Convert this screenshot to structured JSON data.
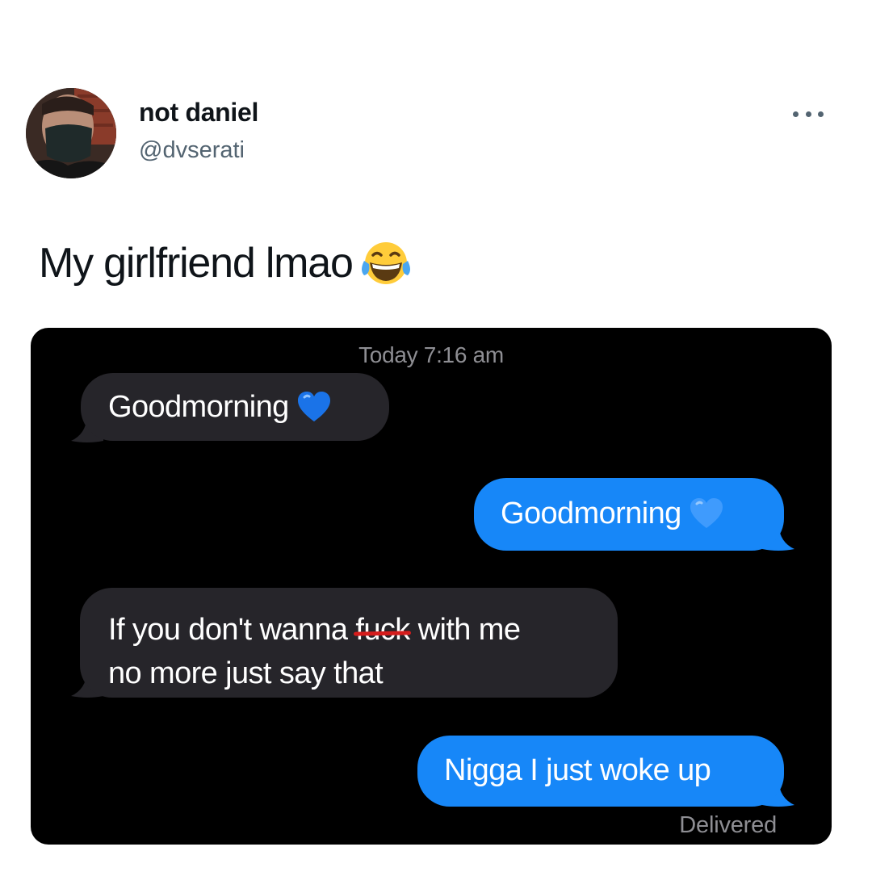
{
  "tweet": {
    "author": {
      "display_name": "not daniel",
      "handle": "@dvserati",
      "avatar_icon": "profile-photo-masked-person"
    },
    "more_icon": "more-horizontal-icon",
    "text": "My girlfriend lmao",
    "text_emoji": "face-with-tears-of-joy-icon"
  },
  "screenshot": {
    "background": "#000000",
    "timestamp": "Today 7:16 am",
    "messages": [
      {
        "direction": "received",
        "text": "Goodmorning",
        "emoji": "blue-heart-icon"
      },
      {
        "direction": "sent",
        "text": "Goodmorning",
        "emoji": "blue-heart-icon"
      },
      {
        "direction": "received",
        "text_before": "If you don't wanna ",
        "struck_word": "fuck",
        "text_line1_after": " with me",
        "text_line2": "no more just say that"
      },
      {
        "direction": "sent",
        "text": "Nigga I just woke up"
      }
    ],
    "status": "Delivered",
    "colors": {
      "received_bubble": "#26252a",
      "sent_bubble": "#1787f8",
      "redaction_line": "#d51c1c"
    }
  }
}
